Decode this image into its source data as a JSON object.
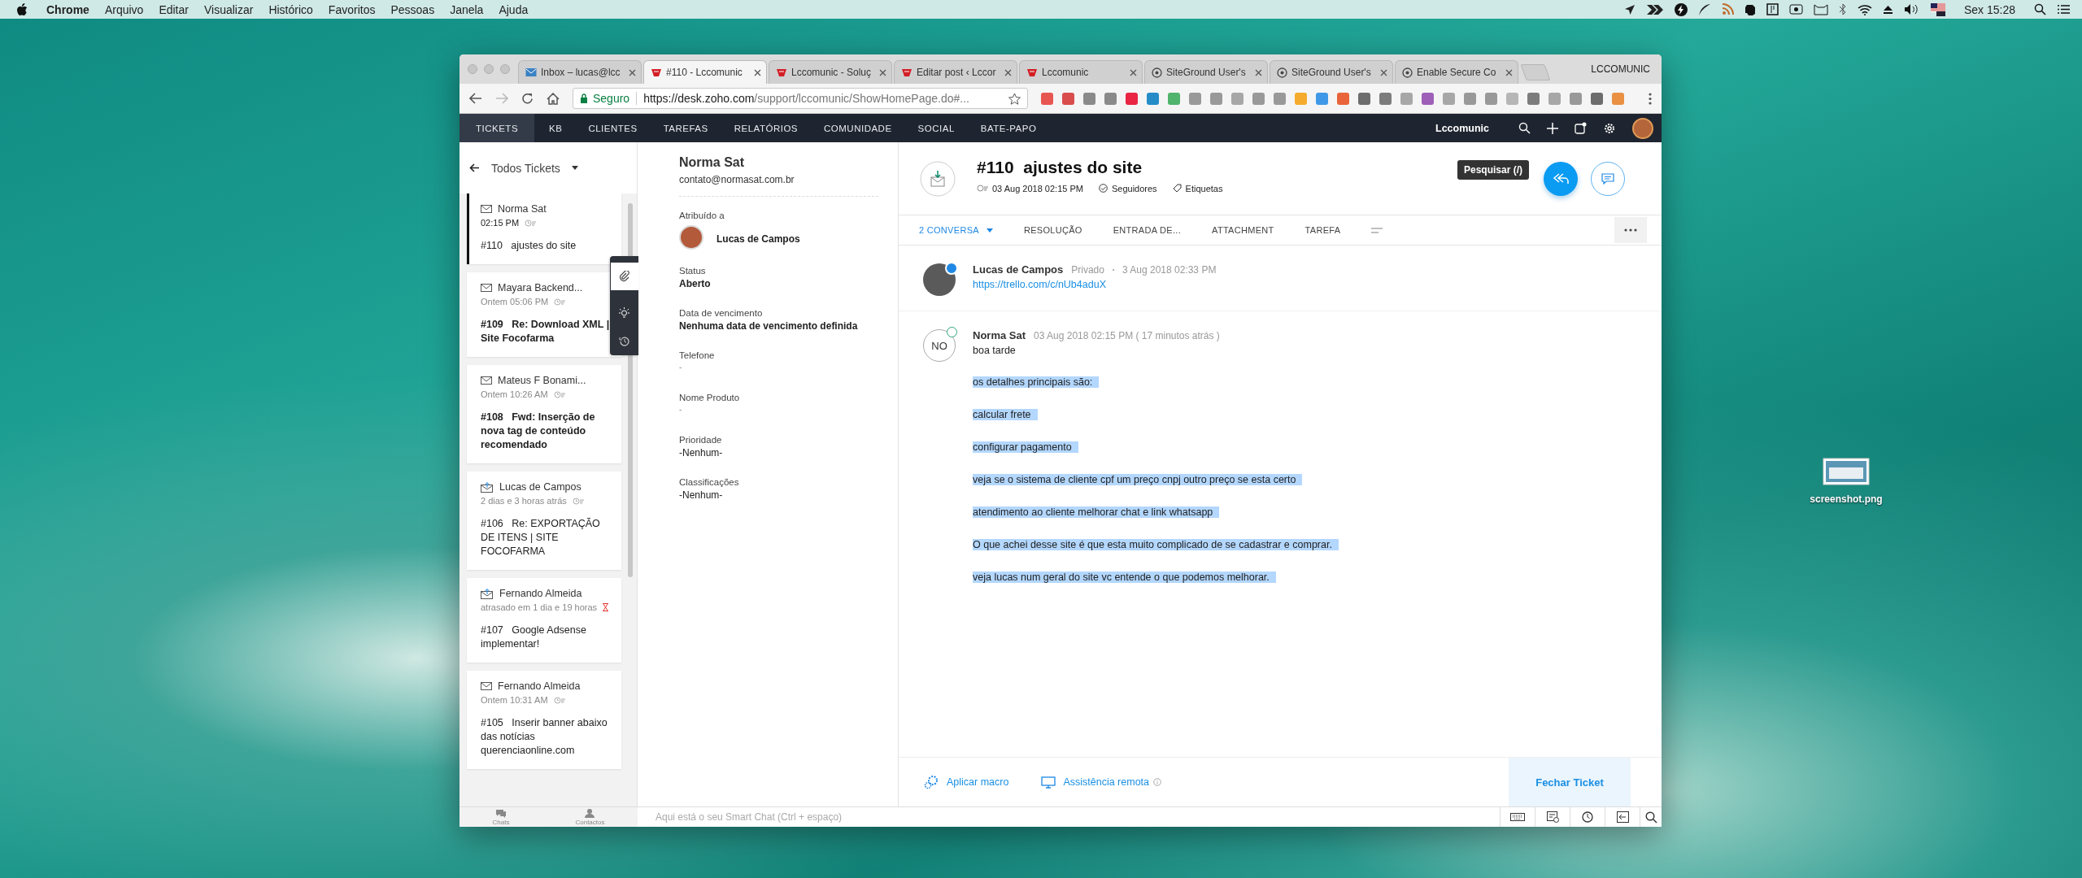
{
  "menubar": {
    "app": "Chrome",
    "menus": [
      "Arquivo",
      "Editar",
      "Visualizar",
      "Histórico",
      "Favoritos",
      "Pessoas",
      "Janela",
      "Ajuda"
    ],
    "clock": "Sex 15:28"
  },
  "desktop": {
    "file_label": "screenshot.png"
  },
  "browser": {
    "tabs": [
      {
        "title": "Inbox – lucas@lcc",
        "selected": false,
        "kind": "mail"
      },
      {
        "title": "#110 - Lccomunic",
        "selected": true,
        "kind": "site"
      },
      {
        "title": "Lccomunic - Soluç",
        "selected": false,
        "kind": "site"
      },
      {
        "title": "Editar post ‹ Lccor",
        "selected": false,
        "kind": "site"
      },
      {
        "title": "Lccomunic",
        "selected": false,
        "kind": "site"
      },
      {
        "title": "SiteGround User's",
        "selected": false,
        "kind": "ground"
      },
      {
        "title": "SiteGround User's",
        "selected": false,
        "kind": "ground"
      },
      {
        "title": "Enable Secure Co",
        "selected": false,
        "kind": "ground"
      }
    ],
    "profile": "LCCOMUNIC",
    "security": "Seguro",
    "url_host": "https://desk.zoho.com",
    "url_path": "/support/lccomunic/ShowHomePage.do#..."
  },
  "nav": {
    "items": [
      {
        "label": "TICKETS",
        "selected": true
      },
      {
        "label": "KB",
        "selected": false
      },
      {
        "label": "CLIENTES",
        "selected": false
      },
      {
        "label": "TAREFAS",
        "selected": false
      },
      {
        "label": "RELATÓRIOS",
        "selected": false
      },
      {
        "label": "COMUNIDADE",
        "selected": false
      },
      {
        "label": "SOCIAL",
        "selected": false
      },
      {
        "label": "BATE-PAPO",
        "selected": false
      }
    ],
    "org": "Lccomunic",
    "tooltip": "Pesquisar (/)"
  },
  "ticket_list": {
    "view": "Todos Tickets",
    "tickets": [
      {
        "contact": "Norma Sat",
        "time": "02:15 PM",
        "number": "#110",
        "subject": "ajustes do site",
        "selected": true,
        "unread": false,
        "kind": "email",
        "overdue": false
      },
      {
        "contact": "Mayara Backend...",
        "time": "Ontem 05:06 PM",
        "number": "#109",
        "subject": "Re: Download XML | Site Focofarma",
        "selected": false,
        "unread": true,
        "kind": "email",
        "overdue": false
      },
      {
        "contact": "Mateus F Bonami...",
        "time": "Ontem 10:26 AM",
        "number": "#108",
        "subject": "Fwd: Inserção de nova tag de conteúdo recomendado",
        "selected": false,
        "unread": true,
        "kind": "email",
        "overdue": false
      },
      {
        "contact": "Lucas de Campos",
        "time": "2 dias e 3 horas atrás",
        "number": "#106",
        "subject": "Re: EXPORTAÇÃO DE ITENS | SITE FOCOFARMA",
        "selected": false,
        "unread": false,
        "kind": "reply",
        "overdue": false
      },
      {
        "contact": "Fernando Almeida",
        "time": "atrasado em 1 dia e 19 horas",
        "number": "#107",
        "subject": "Google Adsense implementar!",
        "selected": false,
        "unread": false,
        "kind": "reply",
        "overdue": true
      },
      {
        "contact": "Fernando Almeida",
        "time": "Ontem 10:31 AM",
        "number": "#105",
        "subject": "Inserir banner abaixo das notícias querenciaonline.com",
        "selected": false,
        "unread": false,
        "kind": "email",
        "overdue": false
      }
    ]
  },
  "contact": {
    "name": "Norma Sat",
    "email": "contato@normasat.com.br",
    "fields": [
      {
        "label": "Atribuído a",
        "value": "Lucas de Campos",
        "kind": "agent"
      },
      {
        "label": "Status",
        "value": "Aberto",
        "kind": "bold"
      },
      {
        "label": "Data de vencimento",
        "value": "Nenhuma data de vencimento definida",
        "kind": "bold"
      },
      {
        "label": "Telefone",
        "value": "-",
        "kind": "empty"
      },
      {
        "label": "Nome Produto",
        "value": "-",
        "kind": "empty"
      },
      {
        "label": "Prioridade",
        "value": "-Nenhum-",
        "kind": "plain"
      },
      {
        "label": "Classificações",
        "value": "-Nenhum-",
        "kind": "plain"
      }
    ]
  },
  "ticket": {
    "title": "#110  ajustes do site",
    "date": "03 Aug 2018 02:15 PM",
    "followers": "Seguidores",
    "tags": "Etiquetas",
    "tabs": [
      {
        "label": "2 CONVERSA",
        "selected": true
      },
      {
        "label": "RESOLUÇÃO",
        "selected": false
      },
      {
        "label": "ENTRADA DE...",
        "selected": false
      },
      {
        "label": "ATTACHMENT",
        "selected": false
      },
      {
        "label": "TAREFA",
        "selected": false
      }
    ],
    "threads": [
      {
        "kind": "comment",
        "author": "Lucas de Campos",
        "visibility": "Privado",
        "date": "3 Aug 2018 02:33 PM",
        "link": "https://trello.com/c/nUb4aduX"
      },
      {
        "kind": "email",
        "author": "Norma Sat",
        "initials": "NO",
        "date": "03 Aug 2018 02:15 PM ( 17 minutos atrás )",
        "greeting": "boa tarde",
        "highlighted": true,
        "paragraphs": [
          "os detalhes principais são:",
          "calcular frete",
          "configurar pagamento",
          "veja se o sistema de cliente cpf um preço cnpj outro preço se esta certo",
          "atendimento ao cliente melhorar chat e link whatsapp",
          "O que achei desse site é que esta muito complicado de se cadastrar e comprar.",
          "veja lucas num geral do site vc entende o que podemos melhorar."
        ]
      }
    ],
    "actions": [
      "Aplicar macro",
      "Assistência remota"
    ],
    "close_button": "Fechar Ticket"
  },
  "bottom_bar": {
    "items": [
      "Chats",
      "Contactos"
    ],
    "smart_chat_placeholder": "Aqui está o seu Smart Chat (Ctrl + espaço)"
  }
}
